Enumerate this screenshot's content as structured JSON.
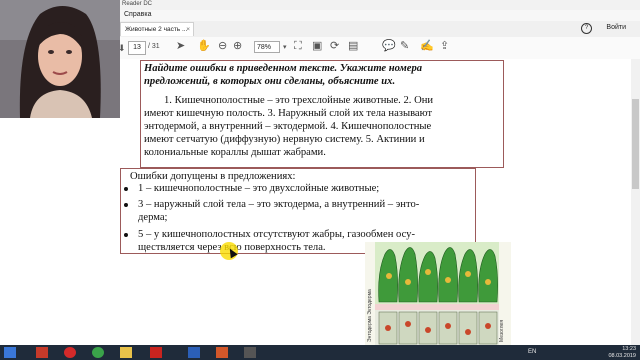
{
  "window": {
    "app_title": "Reader DC",
    "menu_help": "Справка",
    "tab_title": "Животные 2 часть ...",
    "tab_close": "×",
    "help_symbol": "?",
    "login": "Войти"
  },
  "toolbar": {
    "page_current": "13",
    "page_total": "/ 31",
    "zoom": "78%",
    "icons": [
      "prev-page-icon",
      "next-page-icon",
      "hand-tool-icon",
      "zoom-out-icon",
      "zoom-in-icon",
      "fit-page-icon",
      "read-mode-icon",
      "rotate-icon",
      "comment-icon",
      "highlight-icon",
      "sign-icon",
      "share-icon"
    ]
  },
  "document": {
    "task_line1": "Найдите ошибки в приведенном тексте. Укажите номера",
    "task_line2": "предложений, в которых они сделаны, объясните их.",
    "body_lines": [
      "1. Кишечнополостные – это трехслойные животные. 2. Они",
      "имеют кишечную полость. 3. Наружный слой их тела называют",
      "энтодермой, а внутренний – эктодермой. 4. Кишечнополостные",
      "имеют сетчатую (диффузную) нервную систему. 5. Актинии и",
      "колониальные кораллы дышат жабрами."
    ],
    "answer_heading": "Ошибки допущены в предложениях:",
    "answers": [
      "1 – кишечнополостные – это двухслойные животные;",
      "3 – наружный слой тела – это эктодерма, а внутренний – энто-",
      "дерма;",
      "5 – у кишечнополостных отсутствуют жабры, газообмен осу-",
      "ществляется через всю поверхность тела."
    ],
    "figure_label_left": "Энтодерма   Эктодерма",
    "figure_label_right": "Мезоглея"
  },
  "taskbar": {
    "lang": "EN",
    "time": "13:23",
    "date": "08.03.2019",
    "apps": [
      "start-icon",
      "file-explorer-icon",
      "opera-icon",
      "chrome-icon",
      "folder-icon",
      "acrobat-icon",
      "word-icon",
      "powerpoint-icon",
      "camera-icon"
    ]
  }
}
